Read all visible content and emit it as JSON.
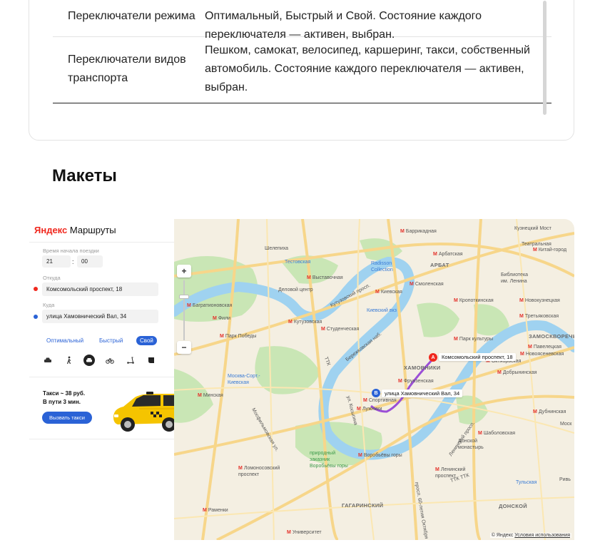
{
  "table": {
    "rows": [
      {
        "element": "Переключатели режима",
        "description": "Оптимальный, Быстрый и Свой. Состояние каждого переключателя — активен, выбран."
      },
      {
        "element": "Переключатели видов транспорта",
        "description": "Пешком, самокат, велосипед, каршеринг, такси, собственный автомобиль. Состояние каждого переключателя — активен, выбран."
      }
    ]
  },
  "section_title": "Макеты",
  "app": {
    "logo_brand": "Яндекс",
    "logo_product": "Маршруты",
    "start_time_label": "Время начала поездки",
    "hours": "21",
    "minutes": "00",
    "from_label": "Откуда",
    "from_value": "Комсомольский проспект, 18",
    "to_label": "Куда",
    "to_value": "улица Хамовнический Вал, 34",
    "modes": [
      "Оптимальный",
      "Быстрый",
      "Свой"
    ],
    "selected_mode": "Свой",
    "transport_icons": [
      "car-icon",
      "pedestrian-icon",
      "taxi-icon",
      "bicycle-icon",
      "scooter-icon",
      "carsharing-icon"
    ],
    "taxi_price": "Такси ~ 38 руб.",
    "taxi_time": "В пути 3 мин.",
    "call_taxi": "Вызвать такси",
    "colors": {
      "from_dot": "#f0281e",
      "to_dot": "#2a62d6",
      "accent": "#2a62d6"
    }
  },
  "map": {
    "point_a": {
      "letter": "A",
      "label": "Комсомольский проспект, 18",
      "color": "#f0281e"
    },
    "point_b": {
      "letter": "B",
      "label": "улица Хамовнический Вал, 34",
      "color": "#2a62d6"
    },
    "route_color": "#9b4fd6",
    "zoom_in": "+",
    "zoom_out": "−",
    "labels": {
      "barrikadnaya": "Баррикадная",
      "shelepikha": "Шелепиха",
      "testovskaya": "Тестовская",
      "vystavochnaya": "Выставочная",
      "delovoy": "Деловой центр",
      "bagrationovskaya": "Багратионовская",
      "fili": "Фили",
      "kutuzovskaya": "Кутузовская",
      "studencheskaya": "Студенческая",
      "kievskaya": "Киевская",
      "kievsky": "Киевский вкз",
      "smolenskaya": "Смоленская",
      "arbat": "АРБАТ",
      "arbatskaya": "Арбатская",
      "biblioteka": "Библиотека им. Ленина",
      "kropotkinskaya": "Кропоткинская",
      "kuznetsky": "Кузнецкий Мост",
      "teatralnaya": "Театральная",
      "kitaygorod": "Китай-город",
      "tretyakovskaya": "Третьяковская",
      "novokuznetskaya": "Новокузнецкая",
      "zamoskvorechye": "ЗАМОСКВОРЕЧЬ",
      "paveletskaya": "Павелецкая",
      "oktyabrskaya": "Октябрьская",
      "dobryninskaya": "Добрынинская",
      "park_kultury": "Парк культуры",
      "park_pobedy": "Парк Победы",
      "minskaya": "Минская",
      "moskva_sort": "Москва-Сорт.-Киевская",
      "khamovniki": "ХАМОВНИКИ",
      "frunzenskaya": "Фрунзенская",
      "sportivnaya": "Спортивная",
      "luzhniki": "Лужники",
      "vorobyovy": "Воробьёвы горы",
      "prirodny": "природный заказник Воробьёвы горы",
      "shabolovskaya": "Шаболовская",
      "donskoy_mon": "Донской монастырь",
      "leninsky": "Ленинский проспект",
      "gagarinsky": "ГАГАРИНСКИЙ",
      "donskoy": "ДОНСКОЙ",
      "lomonosovsky": "Ломоносовский проспект",
      "ramenki": "Раменки",
      "universitet": "Университет",
      "tulskaya": "Тульская",
      "novoslobodskaya": "Новоясеневская",
      "dubrovka": "Дубнинская",
      "mosk": "Моск",
      "riv": "Ривь",
      "radisson": "Radisson Collection",
      "kutuzovsky": "Кутузовский просп.",
      "berezh": "Бережковская наб.",
      "ttk": "ТТК",
      "mosfilm": "Мосфильмовская ул.",
      "kosygina": "ул. Косыгина",
      "ttk2": "ТТК  ТТК",
      "leninsky_pr": "Ленинский просп.",
      "vernadskogo": "просп. 60-летия Октября"
    },
    "attribution_brand": "© Яндекс",
    "attribution_link": "Условия использования"
  }
}
